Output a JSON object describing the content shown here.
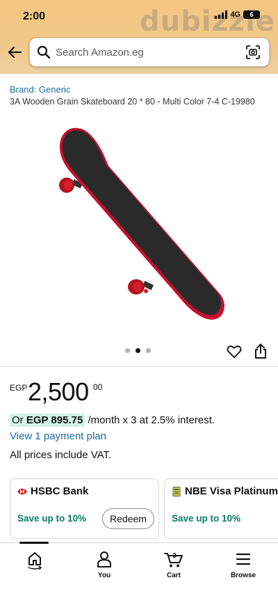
{
  "status_bar": {
    "time": "2:00",
    "network": "4G",
    "battery": "6"
  },
  "watermark": "dubizzle",
  "search": {
    "placeholder": "Search Amazon.eg"
  },
  "product": {
    "brand": "Brand: Generic",
    "title": "3A Wooden Grain Skateboard 20 * 80 - Multi Color 7-4 C-19980",
    "image_dots": {
      "count": 3,
      "active_index": 1
    }
  },
  "price": {
    "currency": "EGP",
    "whole": "2,500",
    "fraction": "00",
    "installment_prefix": "Or",
    "installment_amount": "EGP 895.75",
    "installment_suffix": "/month x 3 at 2.5% interest.",
    "payment_plan_link": "View 1 payment plan",
    "vat_note": "All prices include VAT."
  },
  "offers": [
    {
      "bank": "HSBC Bank",
      "save": "Save up to 10%",
      "button": "Redeem"
    },
    {
      "bank": "NBE Visa Platinum",
      "save": "Save up to 10%"
    }
  ],
  "bottom_nav": [
    {
      "label": "",
      "icon": "home-icon"
    },
    {
      "label": "You",
      "icon": "user-icon"
    },
    {
      "label": "Cart",
      "icon": "cart-icon",
      "badge": "3"
    },
    {
      "label": "Browse",
      "icon": "menu-icon"
    }
  ],
  "colors": {
    "header_gradient_top": "#f5c67f",
    "link": "#1a6aa0",
    "save_green": "#067d62",
    "installment_highlight": "#d2f2e4",
    "skateboard_deck": "#2a2a2a",
    "skateboard_edge": "#c8102e"
  }
}
